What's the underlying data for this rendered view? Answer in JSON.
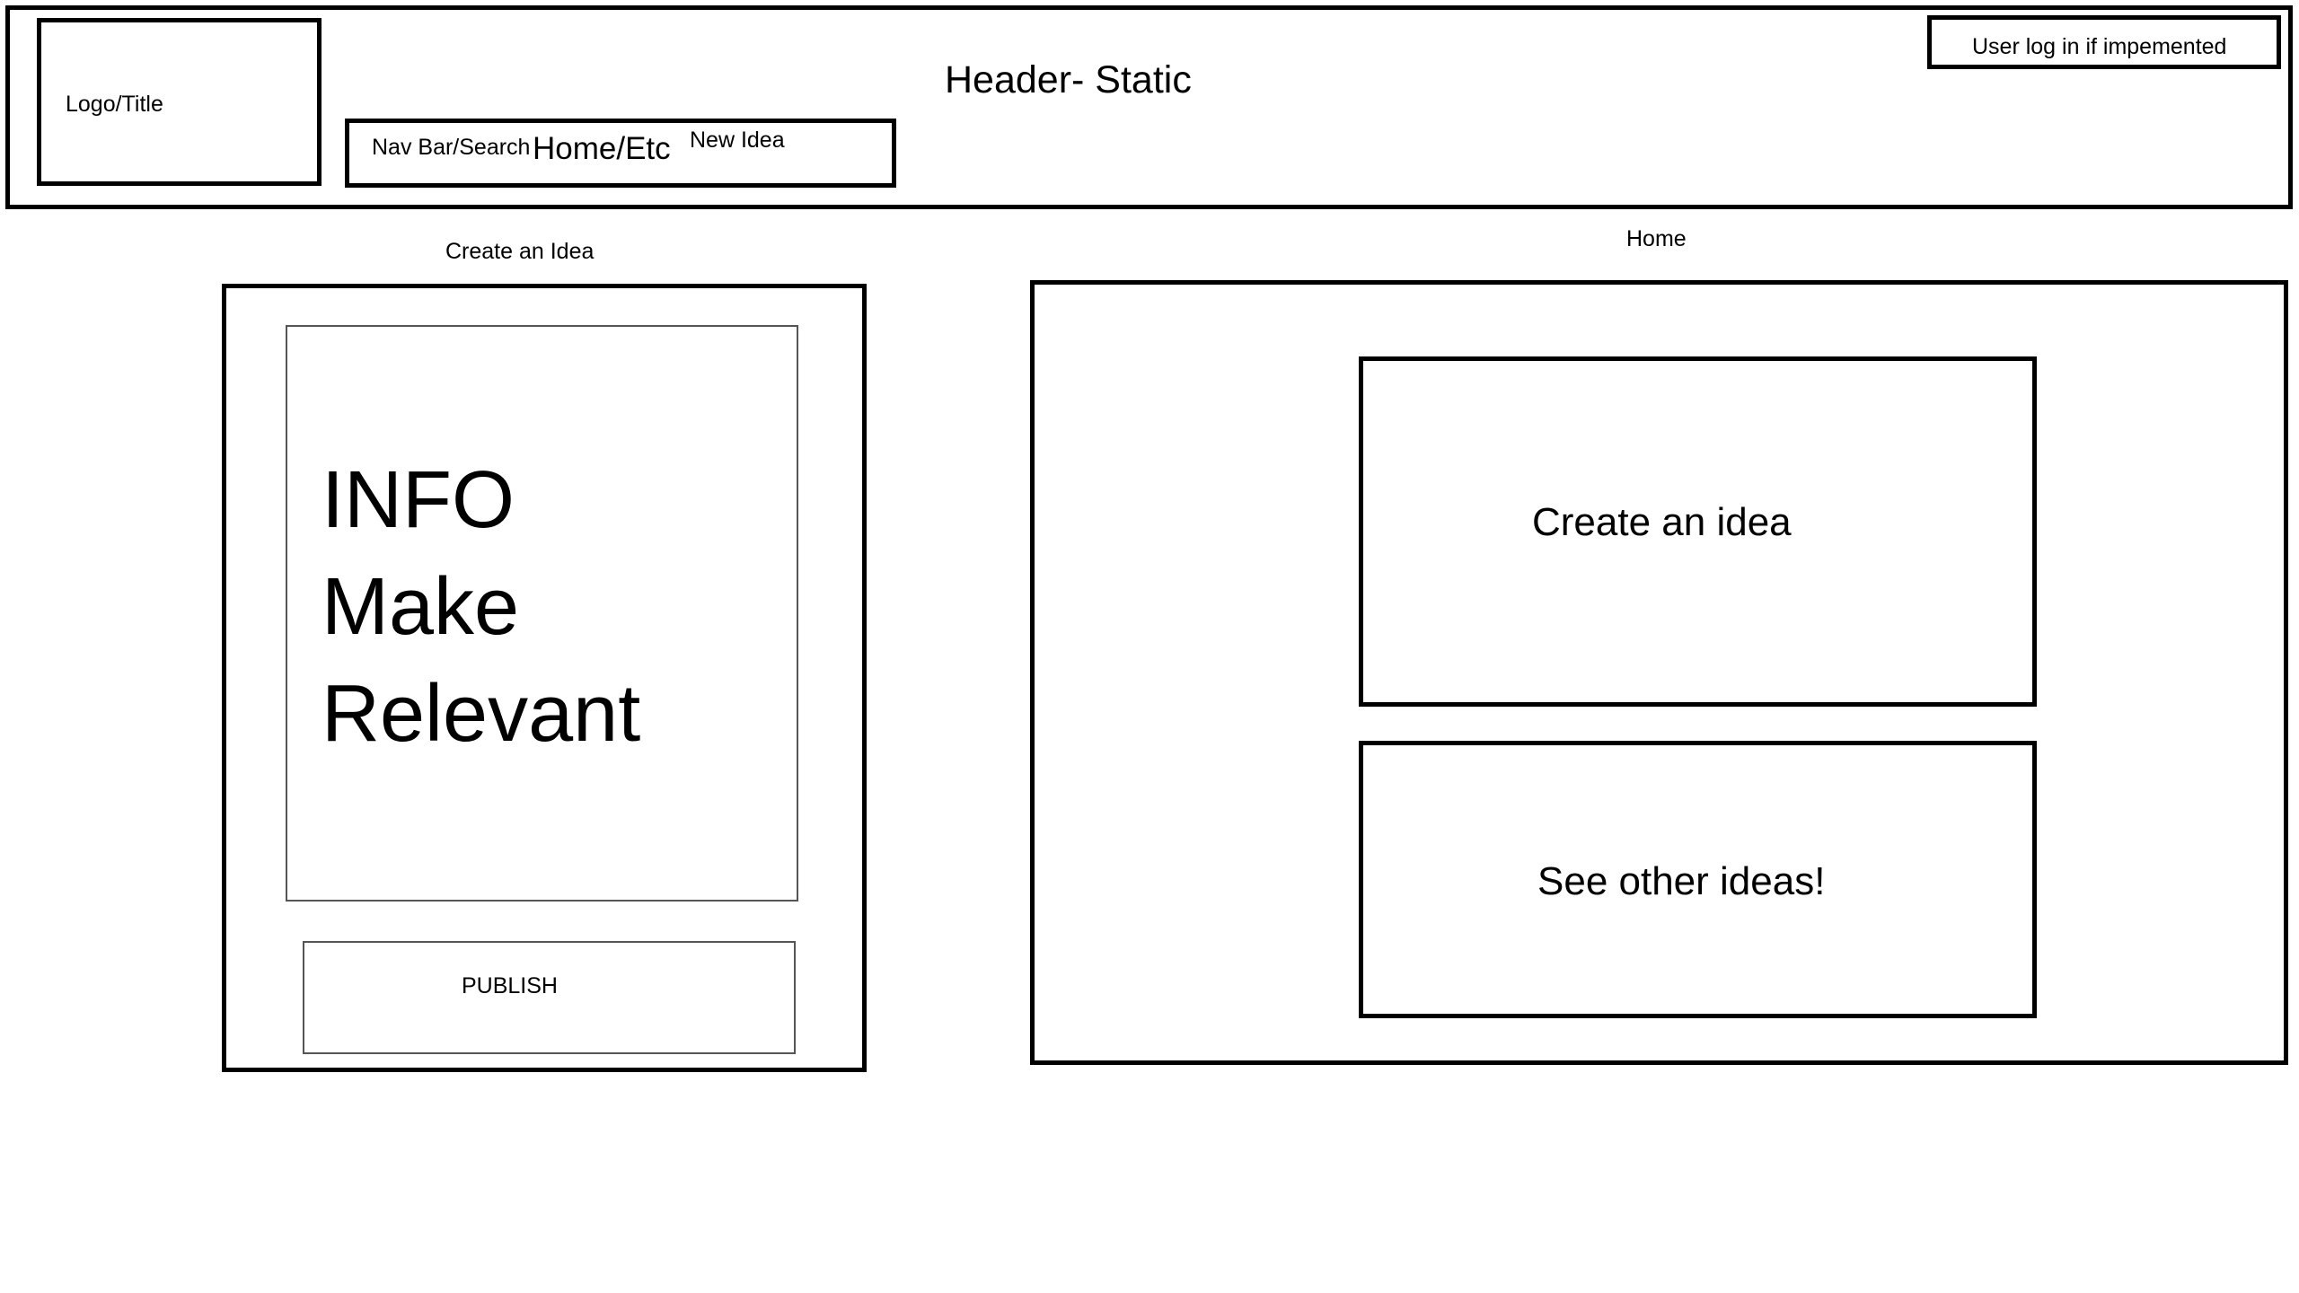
{
  "header": {
    "logo_label": "Logo/Title",
    "title": "Header- Static",
    "login_label": "User log in if impemented",
    "nav": {
      "search_label": "Nav Bar/Search",
      "home_label": "Home/Etc",
      "new_idea_label": "New Idea"
    }
  },
  "create_panel": {
    "caption": "Create an Idea",
    "info_text": "INFO\nMake\nRelevant",
    "publish_label": "PUBLISH"
  },
  "home_panel": {
    "caption": "Home",
    "create_idea_label": "Create an idea",
    "see_ideas_label": "See other ideas!"
  }
}
